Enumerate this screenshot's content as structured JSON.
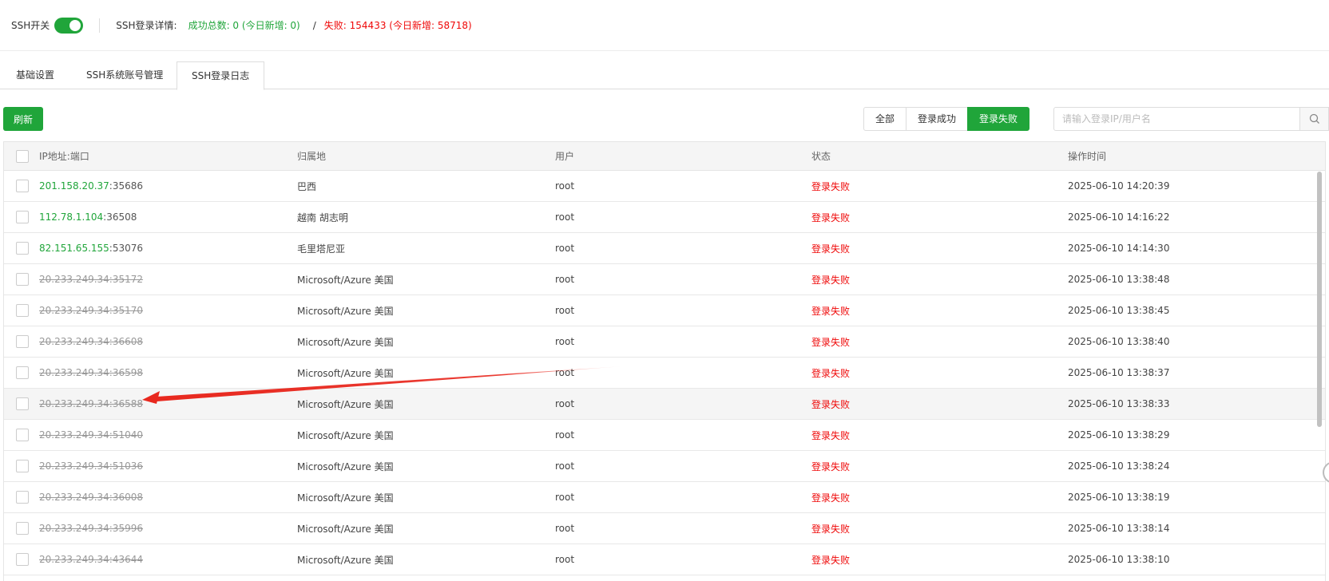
{
  "header": {
    "ssh_switch_label": "SSH开关",
    "ssh_switch_on": true,
    "login_detail_label": "SSH登录详情:",
    "success_stat": "成功总数: 0 (今日新增: 0)",
    "separator": "/",
    "fail_stat": "失败: 154433 (今日新增: 58718)"
  },
  "tabs": [
    {
      "label": "基础设置",
      "active": false
    },
    {
      "label": "SSH系统账号管理",
      "active": false
    },
    {
      "label": "SSH登录日志",
      "active": true
    }
  ],
  "toolbar": {
    "refresh_label": "刷新",
    "filters": [
      {
        "label": "全部",
        "active": false
      },
      {
        "label": "登录成功",
        "active": false
      },
      {
        "label": "登录失败",
        "active": true
      }
    ],
    "search_placeholder": "请输入登录IP/用户名"
  },
  "table": {
    "headers": {
      "ip": "IP地址:端口",
      "location": "归属地",
      "user": "用户",
      "status": "状态",
      "time": "操作时间"
    },
    "rows": [
      {
        "ip": "201.158.20.37",
        "port": ":35686",
        "blocked": false,
        "location": "巴西",
        "user": "root",
        "status": "登录失败",
        "time": "2025-06-10 14:20:39"
      },
      {
        "ip": "112.78.1.104",
        "port": ":36508",
        "blocked": false,
        "location": "越南 胡志明",
        "user": "root",
        "status": "登录失败",
        "time": "2025-06-10 14:16:22"
      },
      {
        "ip": "82.151.65.155",
        "port": ":53076",
        "blocked": false,
        "location": "毛里塔尼亚",
        "user": "root",
        "status": "登录失败",
        "time": "2025-06-10 14:14:30"
      },
      {
        "ip": "20.233.249.34",
        "port": ":35172",
        "blocked": true,
        "location": "Microsoft/Azure 美国",
        "user": "root",
        "status": "登录失败",
        "time": "2025-06-10 13:38:48"
      },
      {
        "ip": "20.233.249.34",
        "port": ":35170",
        "blocked": true,
        "location": "Microsoft/Azure 美国",
        "user": "root",
        "status": "登录失败",
        "time": "2025-06-10 13:38:45"
      },
      {
        "ip": "20.233.249.34",
        "port": ":36608",
        "blocked": true,
        "location": "Microsoft/Azure 美国",
        "user": "root",
        "status": "登录失败",
        "time": "2025-06-10 13:38:40"
      },
      {
        "ip": "20.233.249.34",
        "port": ":36598",
        "blocked": true,
        "location": "Microsoft/Azure 美国",
        "user": "root",
        "status": "登录失败",
        "time": "2025-06-10 13:38:37"
      },
      {
        "ip": "20.233.249.34",
        "port": ":36588",
        "blocked": true,
        "location": "Microsoft/Azure 美国",
        "user": "root",
        "status": "登录失败",
        "time": "2025-06-10 13:38:33"
      },
      {
        "ip": "20.233.249.34",
        "port": ":51040",
        "blocked": true,
        "location": "Microsoft/Azure 美国",
        "user": "root",
        "status": "登录失败",
        "time": "2025-06-10 13:38:29"
      },
      {
        "ip": "20.233.249.34",
        "port": ":51036",
        "blocked": true,
        "location": "Microsoft/Azure 美国",
        "user": "root",
        "status": "登录失败",
        "time": "2025-06-10 13:38:24"
      },
      {
        "ip": "20.233.249.34",
        "port": ":36008",
        "blocked": true,
        "location": "Microsoft/Azure 美国",
        "user": "root",
        "status": "登录失败",
        "time": "2025-06-10 13:38:19"
      },
      {
        "ip": "20.233.249.34",
        "port": ":35996",
        "blocked": true,
        "location": "Microsoft/Azure 美国",
        "user": "root",
        "status": "登录失败",
        "time": "2025-06-10 13:38:14"
      },
      {
        "ip": "20.233.249.34",
        "port": ":43644",
        "blocked": true,
        "location": "Microsoft/Azure 美国",
        "user": "root",
        "status": "登录失败",
        "time": "2025-06-10 13:38:10"
      }
    ]
  },
  "colors": {
    "accent": "#20a53a",
    "fail": "#ef0808",
    "annotation_arrow": "#e8281e"
  }
}
